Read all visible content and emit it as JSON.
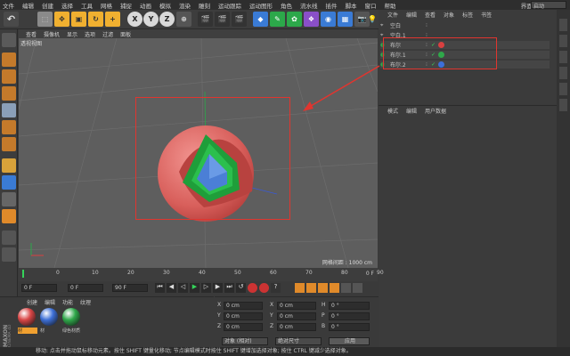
{
  "menubar": {
    "items": [
      "文件",
      "编辑",
      "创建",
      "选择",
      "工具",
      "网格",
      "捕捉",
      "动画",
      "模拟",
      "渲染",
      "雕刻",
      "运动跟踪",
      "运动图形",
      "角色",
      "流水线",
      "插件",
      "脚本",
      "窗口",
      "帮助"
    ],
    "layout_label": "界面:",
    "layout_value": "启动"
  },
  "toolbar": {
    "undo_icon": "undo-icon",
    "x_label": "X",
    "y_label": "Y",
    "z_label": "Z"
  },
  "viewport": {
    "menu": [
      "查看",
      "摄像机",
      "显示",
      "选项",
      "过滤",
      "面板"
    ],
    "camera_label": "透视视图",
    "grid_label": "网格间距 : 1000 cm"
  },
  "object_manager": {
    "menu": [
      "文件",
      "编辑",
      "查看",
      "对象",
      "标签",
      "书签"
    ],
    "objects": [
      {
        "name": "空白",
        "tag_color": ""
      },
      {
        "name": "空白.1",
        "tag_color": ""
      },
      {
        "name": "布尔",
        "tag_color": "#d94040"
      },
      {
        "name": "布尔.1",
        "tag_color": "#2fa84a"
      },
      {
        "name": "布尔.2",
        "tag_color": "#3c6fd9"
      }
    ]
  },
  "attributes": {
    "menu": [
      "模式",
      "编辑",
      "用户数据"
    ]
  },
  "timeline": {
    "ticks": [
      "0",
      "10",
      "20",
      "30",
      "40",
      "50",
      "60",
      "70",
      "80",
      "90"
    ],
    "end_frame": "0 F"
  },
  "transport": {
    "start": "0 F",
    "current": "0 F",
    "end": "90 F",
    "max": "90 F"
  },
  "materials": {
    "menu": [
      "创建",
      "编辑",
      "功能",
      "纹理"
    ],
    "items": [
      {
        "label": "材",
        "color": "#d94646"
      },
      {
        "label": "材",
        "color": "#3d6fd6"
      },
      {
        "label": "绿色材质",
        "color": "#2fa84a"
      }
    ]
  },
  "coordinates": {
    "rows": [
      {
        "axis": "X",
        "pos": "0 cm",
        "axis2": "X",
        "size": "0 cm",
        "axis3": "H",
        "rot": "0 °"
      },
      {
        "axis": "Y",
        "pos": "0 cm",
        "axis2": "Y",
        "size": "0 cm",
        "axis3": "P",
        "rot": "0 °"
      },
      {
        "axis": "Z",
        "pos": "0 cm",
        "axis2": "Z",
        "size": "0 cm",
        "axis3": "B",
        "rot": "0 °"
      }
    ],
    "mode_select": "对象 (相对)",
    "size_select": "绝对尺寸",
    "apply_label": "应用"
  },
  "brand": {
    "maxon": "MAXON",
    "cinema": "CINEMA 4D"
  },
  "statusbar": {
    "text": "移动: 点击并拖动鼠标移动元素。按住 SHIFT 键量化移动; 节点编辑模式时按住 SHIFT 键增加选择对象; 按住 CTRL 键减少选择对象。"
  },
  "colors": {
    "annotation_red": "#e0352f",
    "sphere_red": "#e06a66",
    "inner_green": "#1f9e3a",
    "inner_blue": "#4b7fd6"
  }
}
